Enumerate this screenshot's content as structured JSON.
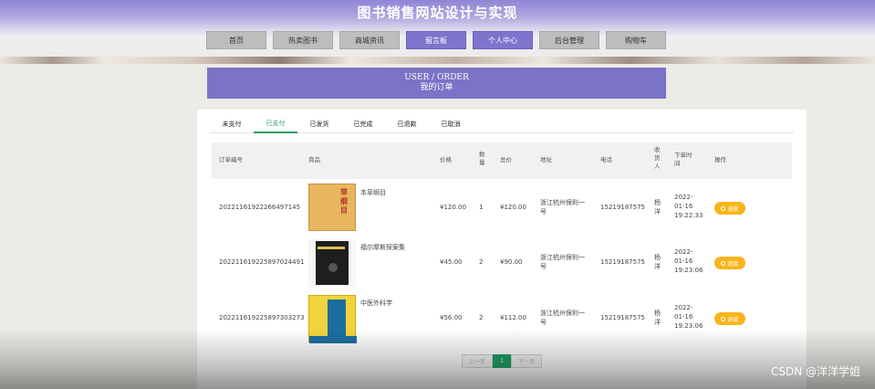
{
  "site": {
    "title": "图书销售网站设计与实现"
  },
  "nav": {
    "items": [
      {
        "label": "首页"
      },
      {
        "label": "热卖图书"
      },
      {
        "label": "商城资讯"
      },
      {
        "label": "留言板"
      },
      {
        "label": "个人中心"
      },
      {
        "label": "后台管理"
      },
      {
        "label": "购物车"
      }
    ]
  },
  "heading": {
    "line1": "USER / ORDER",
    "line2": "我的订单"
  },
  "tabs": [
    "未支付",
    "已支付",
    "已发货",
    "已完成",
    "已退款",
    "已取消"
  ],
  "active_tab": "已支付",
  "table": {
    "columns": {
      "order_no": "订单编号",
      "product": "商品",
      "price": "价格",
      "qty_1": "数",
      "qty_2": "量",
      "total": "总价",
      "address": "地址",
      "phone": "电话",
      "receiver_1": "收",
      "receiver_2": "货",
      "receiver_3": "人",
      "time_1": "下单时",
      "time_2": "间",
      "action": "操作"
    },
    "rows": [
      {
        "order_no": "20221161922266497145",
        "product": "本草纲目",
        "cover_text": "草纲目",
        "price": "¥120.00",
        "qty": "1",
        "total": "¥120.00",
        "address_1": "浙江杭州保利一",
        "address_2": "号",
        "phone": "15219187575",
        "receiver_1": "杨",
        "receiver_2": "洋",
        "date": "2022-",
        "date_2": "01-16",
        "time": "19:22:33",
        "action": "退款"
      },
      {
        "order_no": "20221161922589702449​1",
        "product": "福尔摩斯探案集",
        "price": "¥45.00",
        "qty": "2",
        "total": "¥90.00",
        "address_1": "浙江杭州保利一",
        "address_2": "号",
        "phone": "15219187575",
        "receiver_1": "杨",
        "receiver_2": "洋",
        "date": "2022-",
        "date_2": "01-16",
        "time": "19:23:06",
        "action": "退款"
      },
      {
        "order_no": "20221161922589730327​3",
        "product": "中医外科学",
        "price": "¥56.00",
        "qty": "2",
        "total": "¥112.00",
        "address_1": "浙江杭州保利一",
        "address_2": "号",
        "phone": "15219187575",
        "receiver_1": "杨",
        "receiver_2": "洋",
        "date": "2022-",
        "date_2": "01-16",
        "time": "19:23:06",
        "action": "退款"
      }
    ]
  },
  "pagination": {
    "prev": "上一页",
    "current": "1",
    "next": "下一页"
  },
  "watermark": "CSDN @洋洋学姐",
  "colors": {
    "accent": "#7b73c6",
    "active_tab": "#2f9c6a",
    "refund": "#f8b51a"
  }
}
